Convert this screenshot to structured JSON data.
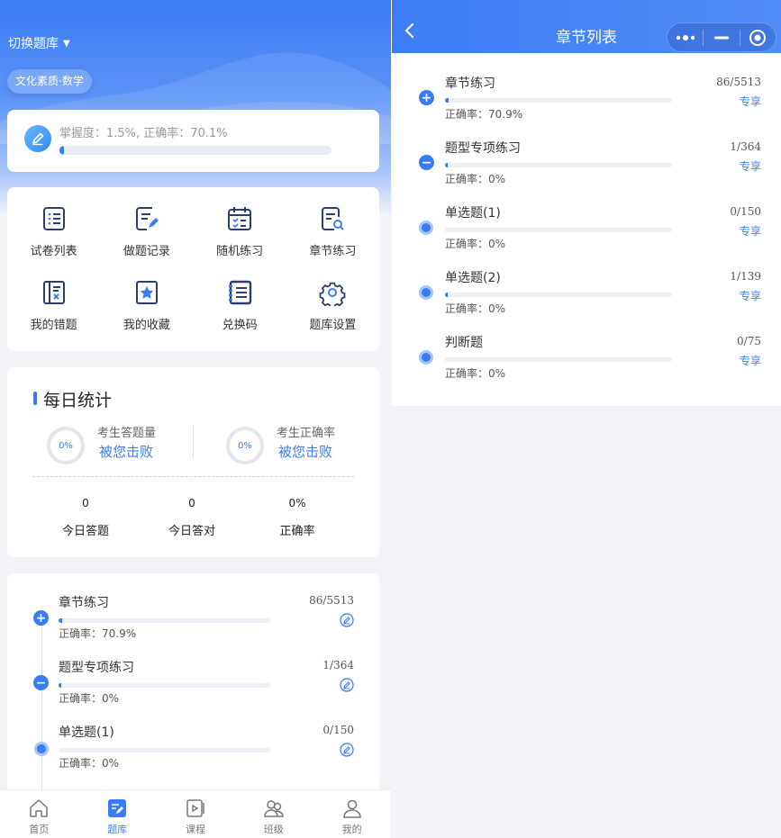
{
  "home": {
    "switch_bank_label": "切换题库",
    "switch_bank_caret": "▼",
    "subject": "文化素质·数学",
    "mastery_text": "掌握度：1.5%, 正确率：70.1%",
    "mastery_progress": 0.015,
    "menu": [
      {
        "label": "试卷列表",
        "icon": "paper-list-icon"
      },
      {
        "label": "做题记录",
        "icon": "record-icon"
      },
      {
        "label": "随机练习",
        "icon": "calendar-icon"
      },
      {
        "label": "章节练习",
        "icon": "chapter-search-icon"
      },
      {
        "label": "我的错题",
        "icon": "wrong-book-icon"
      },
      {
        "label": "我的收藏",
        "icon": "star-icon"
      },
      {
        "label": "兑换码",
        "icon": "code-list-icon"
      },
      {
        "label": "题库设置",
        "icon": "gear-icon"
      }
    ],
    "daily": {
      "title": "每日统计",
      "ring1_value": "0%",
      "ring1_label": "考生答题量",
      "ring1_link": "被您击败",
      "ring2_value": "0%",
      "ring2_label": "考生正确率",
      "ring2_link": "被您击败",
      "cols": [
        {
          "value": "0",
          "label": "今日答题"
        },
        {
          "value": "0",
          "label": "今日答对"
        },
        {
          "value": "0%",
          "label": "正确率"
        }
      ]
    },
    "chapters": [
      {
        "name": "章节练习",
        "count": "86/5513",
        "rate": "正确率：70.9%",
        "progress": 0.0156,
        "node": "plus"
      },
      {
        "name": "题型专项练习",
        "count": "1/364",
        "rate": "正确率：0%",
        "progress": 0.0027,
        "node": "minus"
      },
      {
        "name": "单选题(1)",
        "count": "0/150",
        "rate": "正确率：0%",
        "progress": 0,
        "node": "dot"
      }
    ]
  },
  "tabbar": [
    {
      "label": "首页",
      "icon": "home-icon",
      "active": false
    },
    {
      "label": "题库",
      "icon": "question-bank-icon",
      "active": true
    },
    {
      "label": "课程",
      "icon": "course-icon",
      "active": false
    },
    {
      "label": "班级",
      "icon": "class-icon",
      "active": false
    },
    {
      "label": "我的",
      "icon": "profile-icon",
      "active": false
    }
  ],
  "chapter_list": {
    "title": "章节列表",
    "share_label": "专享",
    "items": [
      {
        "name": "章节练习",
        "count": "86/5513",
        "rate": "正确率：70.9%",
        "progress": 0.0156,
        "node": "plus"
      },
      {
        "name": "题型专项练习",
        "count": "1/364",
        "rate": "正确率：0%",
        "progress": 0.0027,
        "node": "minus"
      },
      {
        "name": "单选题(1)",
        "count": "0/150",
        "rate": "正确率：0%",
        "progress": 0,
        "node": "dot"
      },
      {
        "name": "单选题(2)",
        "count": "1/139",
        "rate": "正确率：0%",
        "progress": 0.0072,
        "node": "dot"
      },
      {
        "name": "判断题",
        "count": "0/75",
        "rate": "正确率：0%",
        "progress": 0,
        "node": "dot"
      }
    ]
  },
  "colors": {
    "accent": "#3a7cf5",
    "accent_light": "#a6c6fa"
  }
}
